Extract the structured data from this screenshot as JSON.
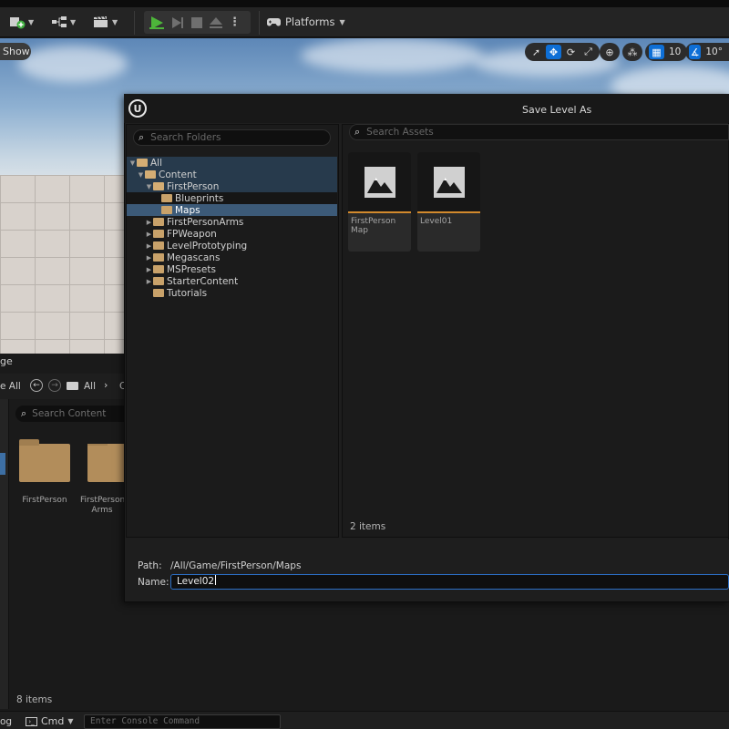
{
  "toolbar": {
    "platforms_label": "Platforms"
  },
  "viewport": {
    "show_label": "Show",
    "grid_snap_value": "10",
    "rotation_snap_value": "10°"
  },
  "content_browser": {
    "title_fragment": "ge",
    "nav_left": "e All",
    "breadcrumb_all": "All",
    "breadcrumb_fragment": "C",
    "search_placeholder": "Search Content",
    "folders": [
      {
        "name": "FirstPerson"
      },
      {
        "name": "FirstPerson Arms"
      }
    ],
    "item_count": "8 items"
  },
  "statusbar": {
    "log_fragment": "og",
    "cmd_label": "Cmd",
    "console_placeholder": "Enter Console Command"
  },
  "dialog": {
    "title": "Save Level As",
    "folder_search_placeholder": "Search Folders",
    "asset_search_placeholder": "Search Assets",
    "tree": [
      {
        "label": "All"
      },
      {
        "label": "Content"
      },
      {
        "label": "FirstPerson"
      },
      {
        "label": "Blueprints"
      },
      {
        "label": "Maps"
      },
      {
        "label": "FirstPersonArms"
      },
      {
        "label": "FPWeapon"
      },
      {
        "label": "LevelPrototyping"
      },
      {
        "label": "Megascans"
      },
      {
        "label": "MSPresets"
      },
      {
        "label": "StarterContent"
      },
      {
        "label": "Tutorials"
      }
    ],
    "assets": [
      {
        "name": "FirstPerson Map"
      },
      {
        "name": "Level01"
      }
    ],
    "item_count": "2 items",
    "path_label": "Path:",
    "path_value": "/All/Game/FirstPerson/Maps",
    "name_label": "Name:",
    "name_value": "Level02"
  }
}
